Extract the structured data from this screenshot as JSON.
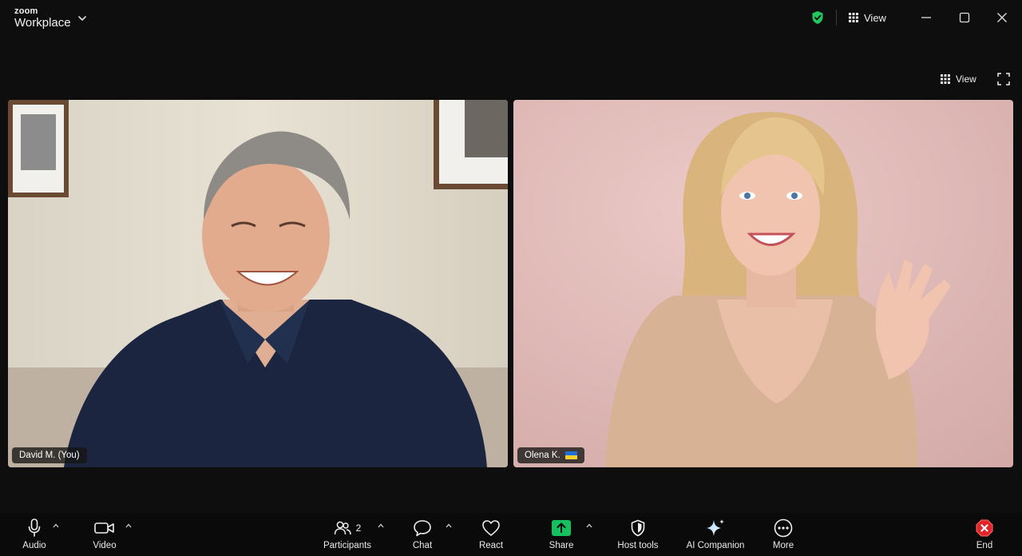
{
  "app": {
    "brand_small": "zoom",
    "brand_name": "Workplace"
  },
  "titlebar": {
    "view_label": "View",
    "icons": [
      "chevron-down-icon",
      "shield-check-icon",
      "grid-icon",
      "minimize-icon",
      "maximize-icon",
      "close-icon"
    ],
    "shield_color": "#22c55e"
  },
  "stage": {
    "view_label": "View",
    "icons": [
      "grid-icon",
      "fullscreen-icon"
    ]
  },
  "participants": [
    {
      "name": "David M. (You)",
      "flag": ""
    },
    {
      "name": "Olena K.",
      "flag": "ukraine-flag"
    }
  ],
  "toolbar": {
    "audio": "Audio",
    "video": "Video",
    "participants": "Participants",
    "participants_count": "2",
    "chat": "Chat",
    "react": "React",
    "share": "Share",
    "host_tools": "Host tools",
    "ai_companion": "AI Companion",
    "more": "More",
    "end": "End",
    "share_color": "#16c05f",
    "end_color": "#e0242a"
  }
}
